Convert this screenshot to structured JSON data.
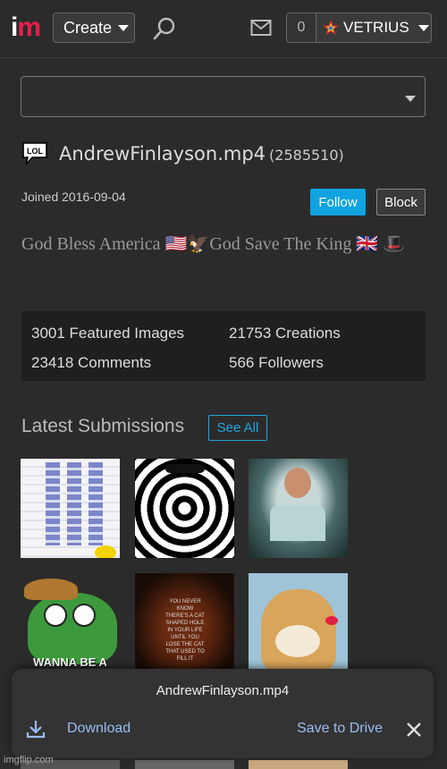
{
  "header": {
    "logo_i": "i",
    "logo_m": "m",
    "create_label": "Create",
    "search_icon": "search-icon",
    "mail_icon": "mail-icon",
    "notification_count": "0",
    "username": "VETRIUS"
  },
  "profile": {
    "badge_icon": "lol-speech-bubble-icon",
    "name": "AndrewFinlayson.mp4",
    "user_id": "(2585510)",
    "joined": "Joined 2016-09-04",
    "follow_label": "Follow",
    "block_label": "Block",
    "bio": "God Bless America 🇺🇸🦅God Save The King 🇬🇧 🎩"
  },
  "stats": {
    "featured": "3001 Featured Images",
    "creations": "21753 Creations",
    "comments": "23418 Comments",
    "followers": "566 Followers"
  },
  "submissions": {
    "heading": "Latest Submissions",
    "see_all_label": "See All",
    "cowboy_caption": "WANNA BE A COWBO",
    "cat_text": "YOU NEVER KNOW THERE'S A CAT SHAPED HOLE IN YOUR LIFE UNTIL YOU LOSE THE CAT THAT USED TO FILL IT"
  },
  "download_sheet": {
    "file_name": "AndrewFinlayson.mp4",
    "download_label": "Download",
    "drive_label": "Save to Drive"
  },
  "watermark": "imgflip.com",
  "colors": {
    "accent_blue": "#0fa3e0",
    "logo_red": "#e8204a",
    "link_blue": "#9bbcf2"
  }
}
